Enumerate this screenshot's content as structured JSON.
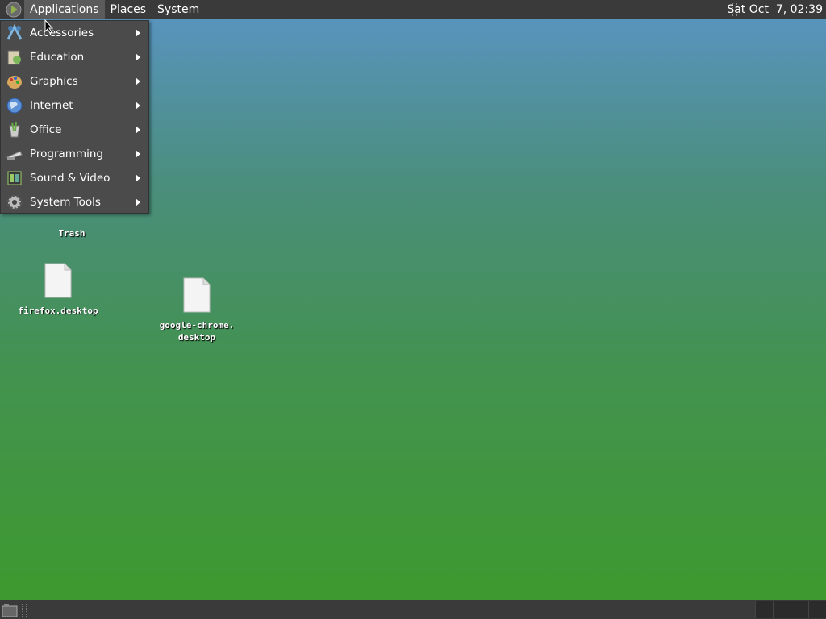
{
  "top_panel": {
    "menus": [
      {
        "label": "Applications",
        "active": true
      },
      {
        "label": "Places",
        "active": false
      },
      {
        "label": "System",
        "active": false
      }
    ],
    "clock": "Sat Oct  7, 02:39"
  },
  "applications_menu": {
    "items": [
      {
        "label": "Accessories",
        "icon": "accessories-icon"
      },
      {
        "label": "Education",
        "icon": "education-icon"
      },
      {
        "label": "Graphics",
        "icon": "graphics-icon"
      },
      {
        "label": "Internet",
        "icon": "internet-icon"
      },
      {
        "label": "Office",
        "icon": "office-icon"
      },
      {
        "label": "Programming",
        "icon": "programming-icon"
      },
      {
        "label": "Sound & Video",
        "icon": "sound-video-icon"
      },
      {
        "label": "System Tools",
        "icon": "system-tools-icon"
      }
    ]
  },
  "desktop": {
    "icons": [
      {
        "label": "Trash",
        "icon": "trash-icon"
      },
      {
        "label": "firefox.desktop",
        "icon": "file-icon"
      },
      {
        "label": "google-chrome.\ndesktop",
        "icon": "file-icon"
      }
    ]
  },
  "colors": {
    "panel": "#3a3a3a",
    "menu_bg": "#4b4b4b",
    "desktop_top": "#5a94c4",
    "desktop_bottom": "#3d9a2c"
  }
}
